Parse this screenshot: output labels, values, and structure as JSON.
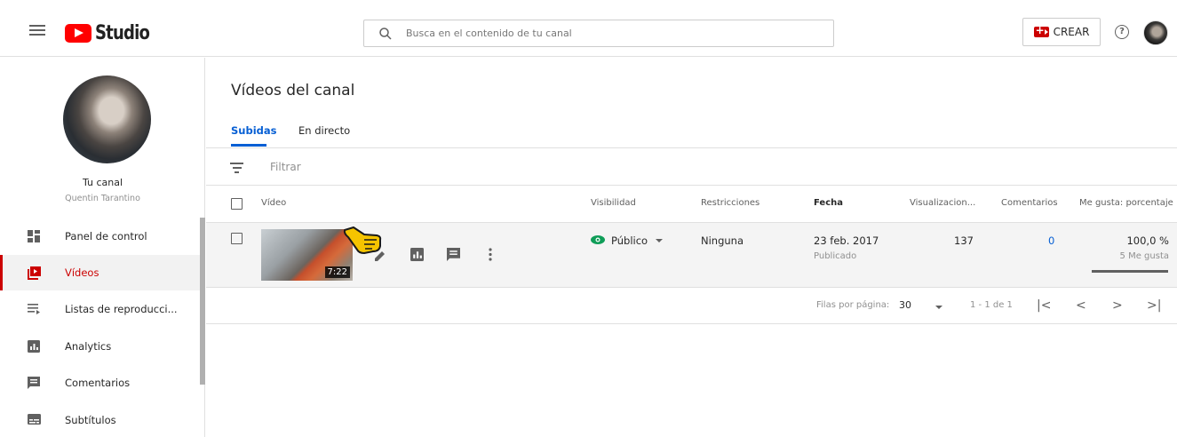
{
  "header": {
    "logo_text": "Studio",
    "search_placeholder": "Busca en el contenido de tu canal",
    "create_label": "CREAR",
    "help_glyph": "?"
  },
  "sidebar": {
    "channel_name": "Tu canal",
    "channel_owner": "Quentin Tarantino",
    "items": [
      {
        "label": "Panel de control",
        "icon": "dashboard-icon",
        "active": false
      },
      {
        "label": "Vídeos",
        "icon": "videos-icon",
        "active": true
      },
      {
        "label": "Listas de reproducci...",
        "icon": "playlists-icon",
        "active": false
      },
      {
        "label": "Analytics",
        "icon": "analytics-icon",
        "active": false
      },
      {
        "label": "Comentarios",
        "icon": "comments-icon",
        "active": false
      },
      {
        "label": "Subtítulos",
        "icon": "subtitles-icon",
        "active": false
      }
    ]
  },
  "main": {
    "title": "Vídeos del canal",
    "tabs": [
      {
        "label": "Subidas",
        "active": true
      },
      {
        "label": "En directo",
        "active": false
      }
    ],
    "filter_placeholder": "Filtrar",
    "columns": [
      "Vídeo",
      "Visibilidad",
      "Restricciones",
      "Fecha",
      "Visualizacion...",
      "Comentarios",
      "Me gusta: porcentaje"
    ],
    "rows": [
      {
        "duration": "7:22",
        "visibility": "Público",
        "restrictions": "Ninguna",
        "date": "23 feb. 2017",
        "date_status": "Publicado",
        "views": "137",
        "comments": "0",
        "likes_pct": "100,0 %",
        "likes_count": "5 Me gusta"
      }
    ],
    "pagination": {
      "rows_per_page_label": "Filas por página:",
      "rows_per_page": "30",
      "range": "1 - 1 de 1"
    }
  },
  "colors": {
    "accent_red": "#cc0000",
    "link_blue": "#065fd4",
    "public_green": "#0f9d58"
  }
}
